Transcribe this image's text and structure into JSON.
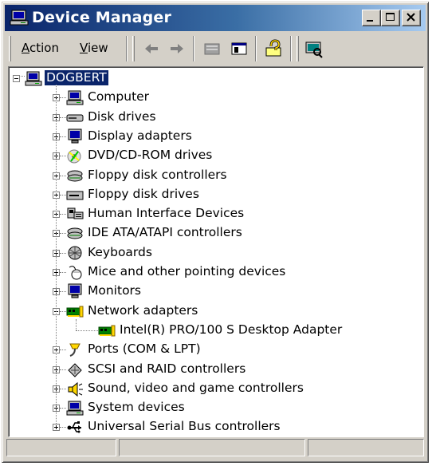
{
  "window": {
    "title": "Device Manager"
  },
  "menu": {
    "action_prefix": "",
    "action_accel": "A",
    "action_rest": "ction",
    "view_accel": "V",
    "view_rest": "iew"
  },
  "tree": {
    "root": "DOGBERT",
    "categories": [
      {
        "label": "Computer",
        "icon": "computer-icon",
        "expanded": false
      },
      {
        "label": "Disk drives",
        "icon": "disk-drive-icon",
        "expanded": false
      },
      {
        "label": "Display adapters",
        "icon": "monitor-icon",
        "expanded": false
      },
      {
        "label": "DVD/CD-ROM drives",
        "icon": "cdrom-icon",
        "expanded": false
      },
      {
        "label": "Floppy disk controllers",
        "icon": "controller-icon",
        "expanded": false
      },
      {
        "label": "Floppy disk drives",
        "icon": "floppy-drive-icon",
        "expanded": false
      },
      {
        "label": "Human Interface Devices",
        "icon": "hid-icon",
        "expanded": false
      },
      {
        "label": "IDE ATA/ATAPI controllers",
        "icon": "controller-icon",
        "expanded": false
      },
      {
        "label": "Keyboards",
        "icon": "keyboard-icon",
        "expanded": false
      },
      {
        "label": "Mice and other pointing devices",
        "icon": "mouse-icon",
        "expanded": false
      },
      {
        "label": "Monitors",
        "icon": "monitor-icon",
        "expanded": false
      },
      {
        "label": "Network adapters",
        "icon": "network-card-icon",
        "expanded": true,
        "children": [
          {
            "label": "Intel(R) PRO/100 S Desktop Adapter",
            "icon": "network-card-icon"
          }
        ]
      },
      {
        "label": "Ports (COM & LPT)",
        "icon": "port-icon",
        "expanded": false
      },
      {
        "label": "SCSI and RAID controllers",
        "icon": "scsi-icon",
        "expanded": false
      },
      {
        "label": "Sound, video and game controllers",
        "icon": "speaker-icon",
        "expanded": false
      },
      {
        "label": "System devices",
        "icon": "computer-icon",
        "expanded": false
      },
      {
        "label": "Universal Serial Bus controllers",
        "icon": "usb-icon",
        "expanded": false
      }
    ]
  },
  "colors": {
    "title_start": "#0a246a",
    "title_end": "#a6caf0",
    "face": "#d4d0c8",
    "selection": "#0a246a"
  }
}
